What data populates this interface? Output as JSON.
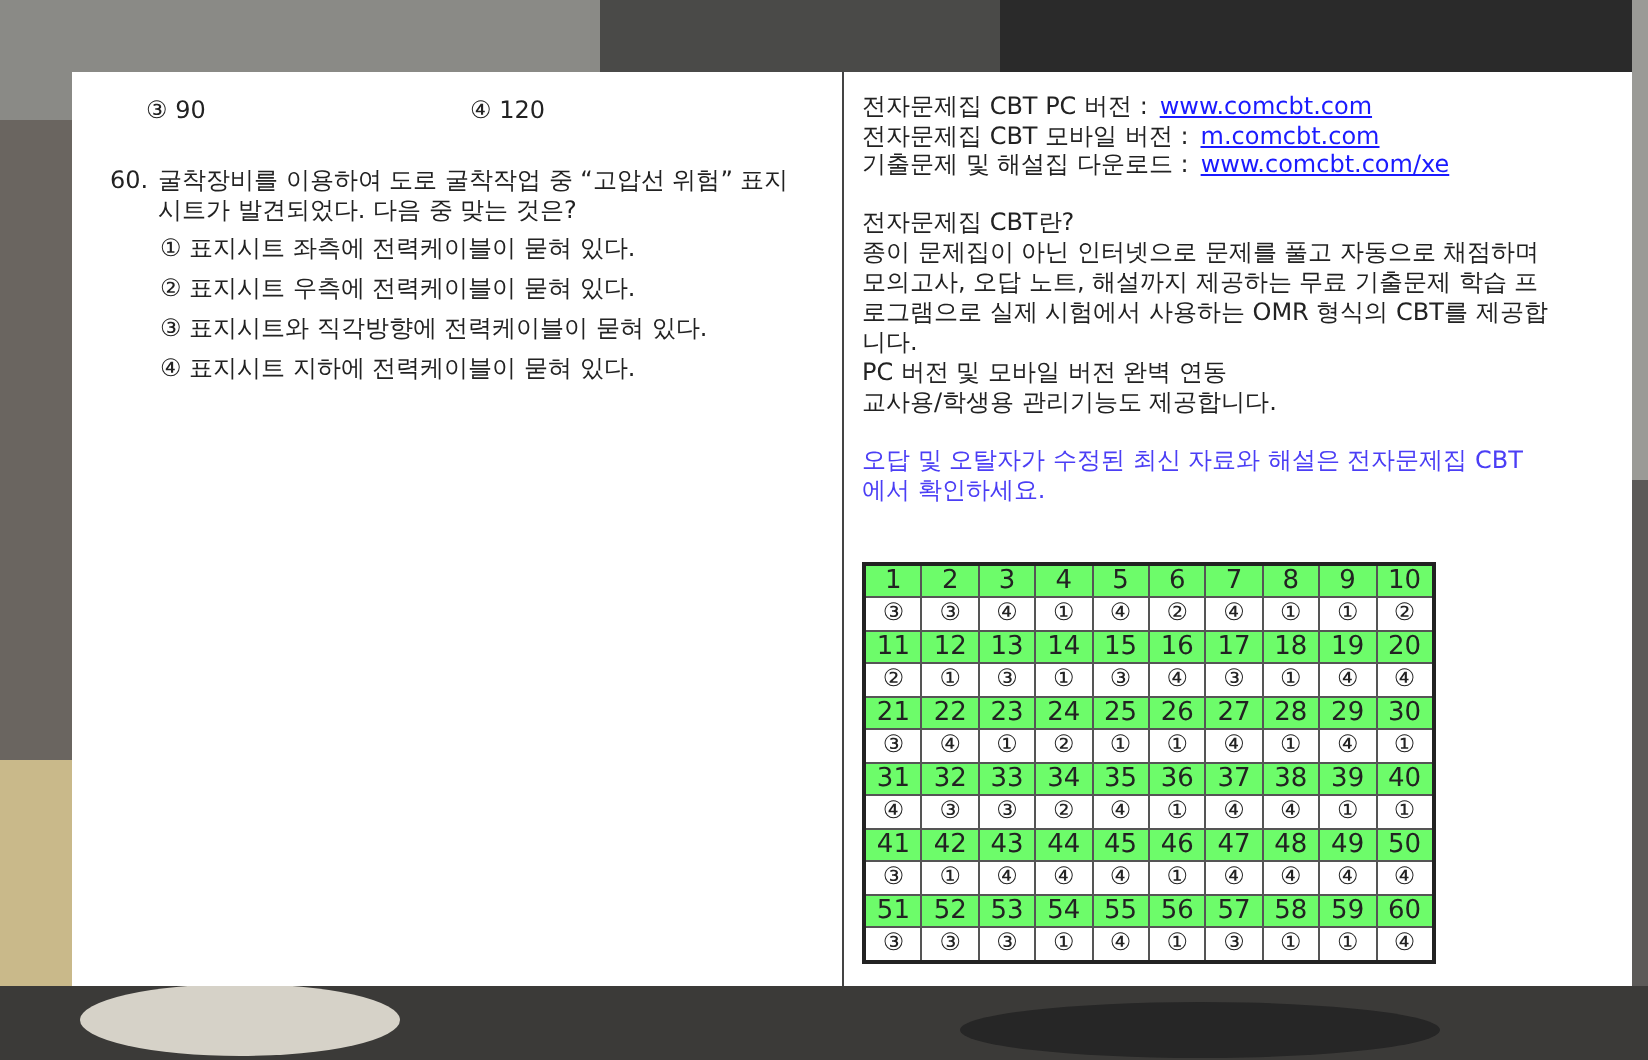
{
  "prev_options": [
    {
      "mark": "③",
      "text": "90"
    },
    {
      "mark": "④",
      "text": "120"
    }
  ],
  "question": {
    "number": "60.",
    "lines": [
      "굴착장비를 이용하여 도로 굴착작업 중 “고압선 위험” 표지",
      "시트가 발견되었다. 다음 중 맞는 것은?"
    ],
    "options": [
      {
        "mark": "①",
        "text": "표지시트 좌측에 전력케이블이 묻혀 있다."
      },
      {
        "mark": "②",
        "text": "표지시트 우측에 전력케이블이 묻혀 있다."
      },
      {
        "mark": "③",
        "text": "표지시트와 직각방향에 전력케이블이 묻혀 있다."
      },
      {
        "mark": "④",
        "text": "표지시트 지하에 전력케이블이 묻혀 있다."
      }
    ]
  },
  "links": [
    {
      "label": "전자문제집 CBT PC 버전 :",
      "url": "www.comcbt.com"
    },
    {
      "label": "전자문제집 CBT 모바일 버전 :",
      "url": "m.comcbt.com"
    },
    {
      "label": "기출문제 및 해설집 다운로드  :",
      "url": "www.comcbt.com/xe"
    }
  ],
  "about": [
    "전자문제집 CBT란?",
    "종이 문제집이 아닌 인터넷으로 문제를 풀고 자동으로 채점하며",
    "모의고사, 오답 노트, 해설까지 제공하는 무료 기출문제 학습 프",
    "로그램으로 실제 시험에서 사용하는 OMR 형식의 CBT를 제공합",
    "니다.",
    "PC 버전 및 모바일 버전 완벽 연동",
    "교사용/학생용 관리기능도 제공합니다."
  ],
  "notice": [
    "오답 및 오탈자가 수정된 최신 자료와 해설은 전자문제집 CBT",
    "에서 확인하세요."
  ],
  "answer_table": [
    {
      "numbers": [
        "1",
        "2",
        "3",
        "4",
        "5",
        "6",
        "7",
        "8",
        "9",
        "10"
      ],
      "answers": [
        "③",
        "③",
        "④",
        "①",
        "④",
        "②",
        "④",
        "①",
        "①",
        "②"
      ]
    },
    {
      "numbers": [
        "11",
        "12",
        "13",
        "14",
        "15",
        "16",
        "17",
        "18",
        "19",
        "20"
      ],
      "answers": [
        "②",
        "①",
        "③",
        "①",
        "③",
        "④",
        "③",
        "①",
        "④",
        "④"
      ]
    },
    {
      "numbers": [
        "21",
        "22",
        "23",
        "24",
        "25",
        "26",
        "27",
        "28",
        "29",
        "30"
      ],
      "answers": [
        "③",
        "④",
        "①",
        "②",
        "①",
        "①",
        "④",
        "①",
        "④",
        "①"
      ]
    },
    {
      "numbers": [
        "31",
        "32",
        "33",
        "34",
        "35",
        "36",
        "37",
        "38",
        "39",
        "40"
      ],
      "answers": [
        "④",
        "③",
        "③",
        "②",
        "④",
        "①",
        "④",
        "④",
        "①",
        "①"
      ]
    },
    {
      "numbers": [
        "41",
        "42",
        "43",
        "44",
        "45",
        "46",
        "47",
        "48",
        "49",
        "50"
      ],
      "answers": [
        "③",
        "①",
        "④",
        "④",
        "④",
        "①",
        "④",
        "④",
        "④",
        "④"
      ]
    },
    {
      "numbers": [
        "51",
        "52",
        "53",
        "54",
        "55",
        "56",
        "57",
        "58",
        "59",
        "60"
      ],
      "answers": [
        "③",
        "③",
        "③",
        "①",
        "④",
        "①",
        "③",
        "①",
        "①",
        "④"
      ]
    }
  ]
}
